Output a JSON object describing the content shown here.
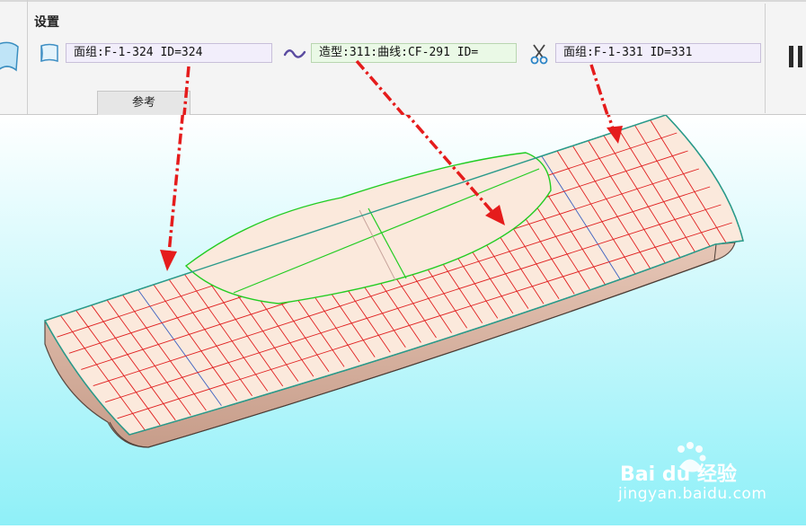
{
  "settings": {
    "title": "设置"
  },
  "fields": {
    "surface1": "面组:F-1-324 ID=324",
    "curve": "造型:311:曲线:CF-291 ID=",
    "surface2": "面组:F-1-331 ID=331"
  },
  "tabs": {
    "reference": "参考"
  },
  "icons": {
    "left": "surface-icon",
    "quilt": "quilt-icon",
    "curve": "curve-icon",
    "trim": "scissors-icon",
    "pause": "pause-icon"
  },
  "colors": {
    "ribbon_bg": "#f4f4f4",
    "viewport_top": "#ffffff",
    "viewport_bottom": "#8ff0f8",
    "surface_fill": "#fbe9dc",
    "grid_red": "#e02020",
    "curve_green": "#22cc22",
    "edge_teal": "#2a9a8a",
    "arrow_red": "#e51c1c"
  },
  "watermark": {
    "logo": "Bai du 经验",
    "url": "jingyan.baidu.com"
  }
}
